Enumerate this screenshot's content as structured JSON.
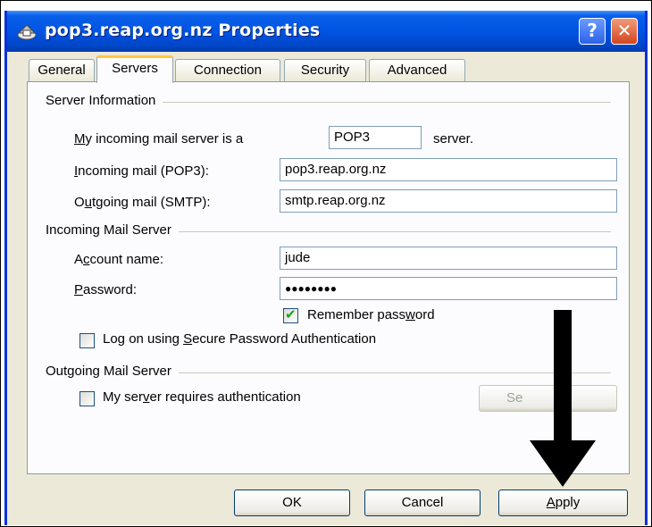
{
  "window": {
    "title": "pop3.reap.org.nz Properties",
    "help_glyph": "?",
    "close_glyph": "✕"
  },
  "tabs": [
    {
      "label": "General"
    },
    {
      "label": "Servers",
      "active": true
    },
    {
      "label": "Connection"
    },
    {
      "label": "Security"
    },
    {
      "label": "Advanced"
    }
  ],
  "server_info": {
    "legend": "Server Information",
    "incoming_type_prefix": "y incoming mail server is a",
    "incoming_type_accel": "M",
    "incoming_type_value": "POP3",
    "incoming_type_suffix": "server.",
    "incoming_label_accel": "I",
    "incoming_label_rest": "ncoming mail (POP3):",
    "incoming_value": "pop3.reap.org.nz",
    "outgoing_label_pre": "O",
    "outgoing_label_accel": "u",
    "outgoing_label_rest": "tgoing mail (SMTP):",
    "outgoing_value": "smtp.reap.org.nz"
  },
  "incoming_server": {
    "legend": "Incoming Mail Server",
    "account_label_pre": "A",
    "account_label_accel": "c",
    "account_label_rest": "count name:",
    "account_value": "jude",
    "password_label_accel": "P",
    "password_label_rest": "assword:",
    "password_value": "●●●●●●●●",
    "remember_pre": "Remember pass",
    "remember_accel": "w",
    "remember_rest": "ord",
    "remember_checked": true,
    "spa_pre": "Log on using ",
    "spa_accel": "S",
    "spa_rest": "ecure Password Authentication",
    "spa_checked": false
  },
  "outgoing_server": {
    "legend": "Outgoing Mail Server",
    "auth_pre": "My ser",
    "auth_accel": "v",
    "auth_rest": "er requires authentication",
    "auth_checked": false,
    "settings_label_visible": "Se"
  },
  "buttons": {
    "ok": "OK",
    "cancel": "Cancel",
    "apply_accel": "A",
    "apply_rest": "pply"
  },
  "colors": {
    "titlebar": "#0054e3",
    "dialog_bg": "#ece9d8",
    "arrow": "#000000",
    "check": "#21a121"
  }
}
